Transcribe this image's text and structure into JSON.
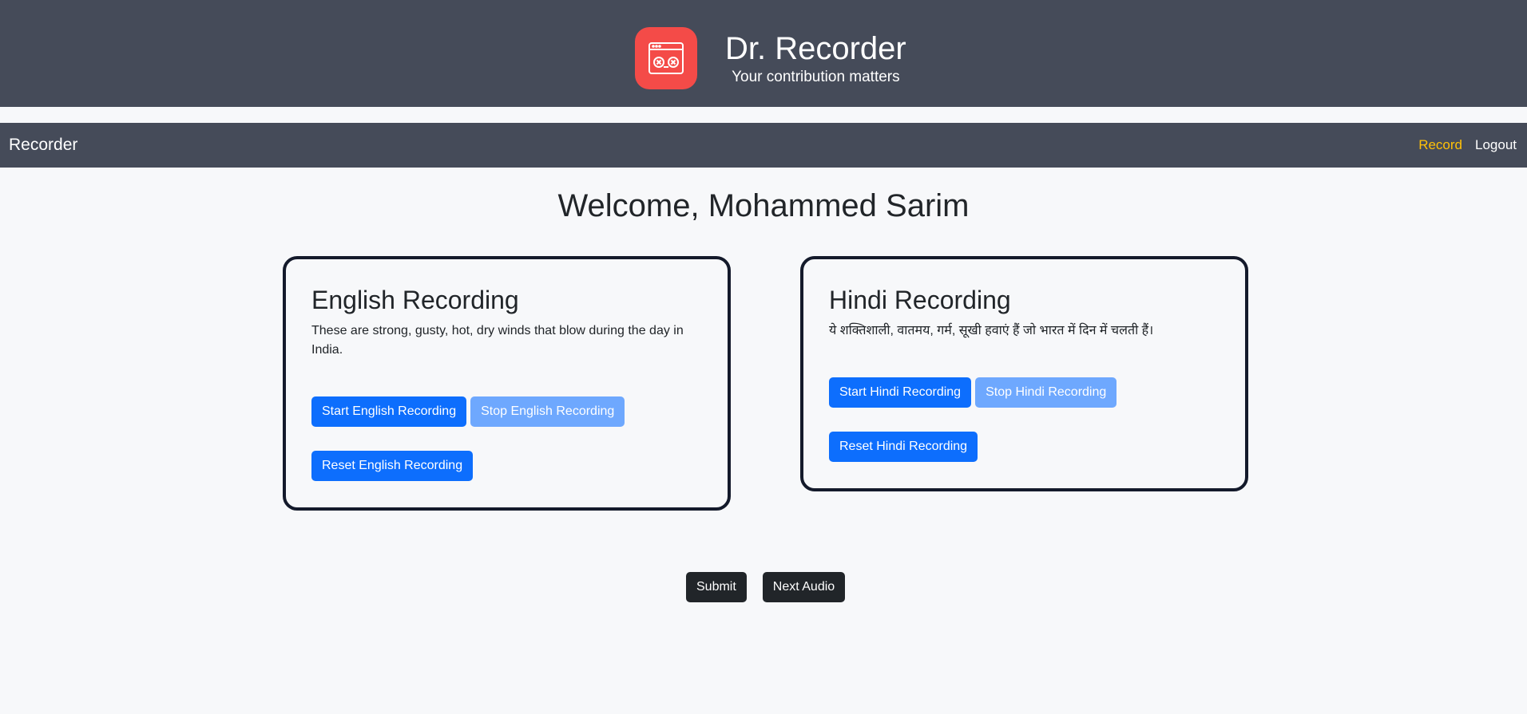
{
  "header": {
    "title": "Dr. Recorder",
    "subtitle": "Your contribution matters",
    "logo_icon": "recorder-window-icon",
    "logo_color": "#f44b48"
  },
  "navbar": {
    "brand": "Recorder",
    "links": [
      {
        "label": "Record",
        "active": true
      },
      {
        "label": "Logout",
        "active": false
      }
    ],
    "active_color": "#ffc107"
  },
  "main": {
    "welcome": "Welcome, Mohammed Sarim",
    "cards": {
      "english": {
        "title": "English Recording",
        "text": "These are strong, gusty, hot, dry winds that blow during the day in India.",
        "start": "Start English Recording",
        "stop": "Stop English Recording",
        "reset": "Reset English Recording"
      },
      "hindi": {
        "title": "Hindi Recording",
        "text": "ये शक्तिशाली, वातमय, गर्म, सूखी हवाएं हैं जो भारत में दिन में चलती हैं।",
        "start": "Start Hindi Recording",
        "stop": "Stop Hindi Recording",
        "reset": "Reset Hindi Recording"
      }
    },
    "actions": {
      "submit": "Submit",
      "next": "Next Audio"
    }
  },
  "colors": {
    "header_bg": "#454b59",
    "primary": "#0d6efd",
    "primary_disabled": "#6ea8fe",
    "dark_button": "#212529",
    "card_border": "#141a2b"
  }
}
